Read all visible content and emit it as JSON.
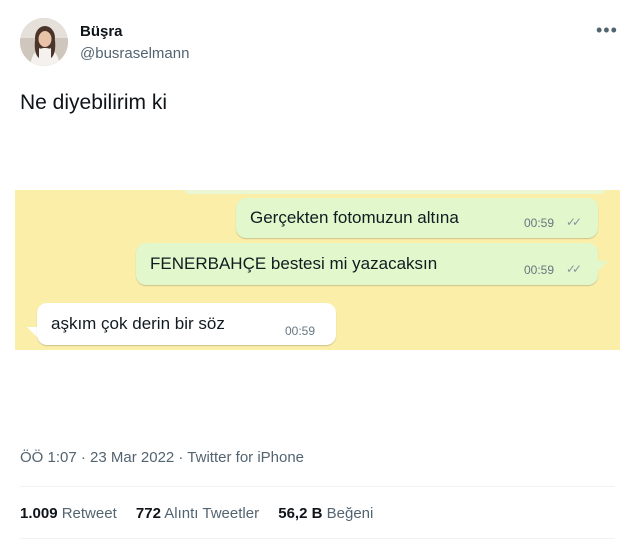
{
  "tweet": {
    "author_name": "Büşra",
    "author_handle": "@busraselmann",
    "text": "Ne diyebilirim ki",
    "more_icon": "more-horizontal-icon"
  },
  "chat": {
    "messages": [
      {
        "text": "Gerçekten fotomuzun altına",
        "time": "00:59",
        "direction": "outgoing",
        "status": "read-double-check"
      },
      {
        "text": "FENERBAHÇE bestesi mi yazacaksın",
        "time": "00:59",
        "direction": "outgoing",
        "status": "read-double-check"
      },
      {
        "text": "aşkım çok derin bir söz",
        "time": "00:59",
        "direction": "incoming"
      }
    ],
    "colors": {
      "background": "#faeea8",
      "outgoing": "#e2f7cb",
      "incoming": "#ffffff"
    }
  },
  "meta": {
    "line": "ÖÖ 1:07 · 23 Mar 2022 · Twitter for iPhone"
  },
  "stats": {
    "retweets_count": "1.009",
    "retweets_label": "Retweet",
    "quotes_count": "772",
    "quotes_label": "Alıntı Tweetler",
    "likes_count": "56,2 B",
    "likes_label": "Beğeni"
  }
}
